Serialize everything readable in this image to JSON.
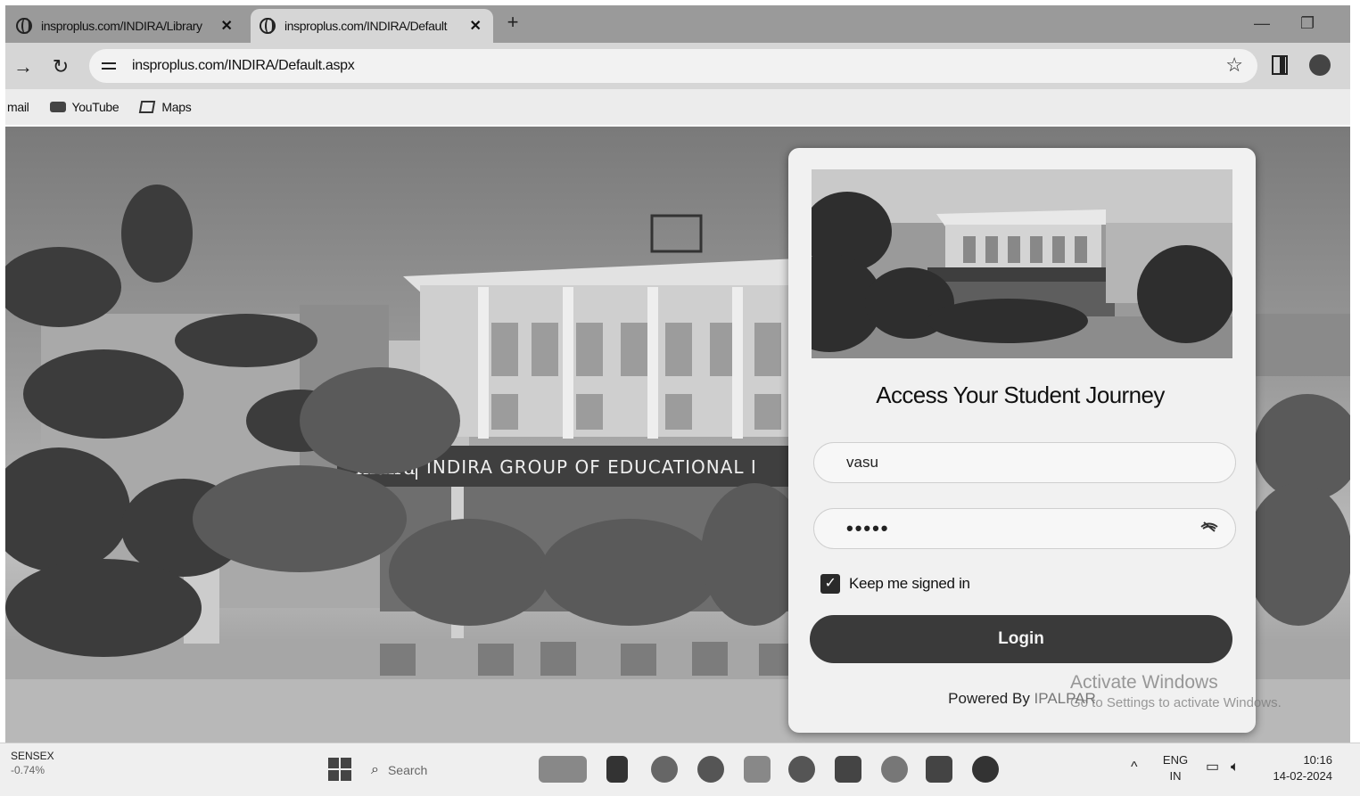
{
  "browser": {
    "tabs": [
      {
        "title": "insproplus.com/INDIRA/Library",
        "active": false
      },
      {
        "title": "insproplus.com/INDIRA/Default",
        "active": true
      }
    ],
    "new_tab": "+",
    "url": "insproplus.com/INDIRA/Default.aspx",
    "bookmarks": [
      {
        "label": "mail",
        "icon": "mail-icon"
      },
      {
        "label": "YouTube",
        "icon": "youtube-icon"
      },
      {
        "label": "Maps",
        "icon": "maps-icon"
      }
    ]
  },
  "scene": {
    "banner_logo": "Indira",
    "banner_text": "INDIRA GROUP OF EDUCATIONAL I"
  },
  "login": {
    "title": "Access Your Student Journey",
    "username": "vasu",
    "password_masked": "•••••",
    "remember_label": "Keep me signed in",
    "remember_checked": true,
    "login_label": "Login",
    "powered_prefix": "Powered By ",
    "powered_brand": "IPALPAR"
  },
  "watermark": {
    "line1": "Activate Windows",
    "line2": "Go to Settings to activate Windows."
  },
  "taskbar": {
    "ticker_name": "SENSEX",
    "ticker_change": "-0.74%",
    "search_placeholder": "Search",
    "lang": "ENG",
    "region": "IN",
    "time": "10:16",
    "date": "14-02-2024"
  }
}
